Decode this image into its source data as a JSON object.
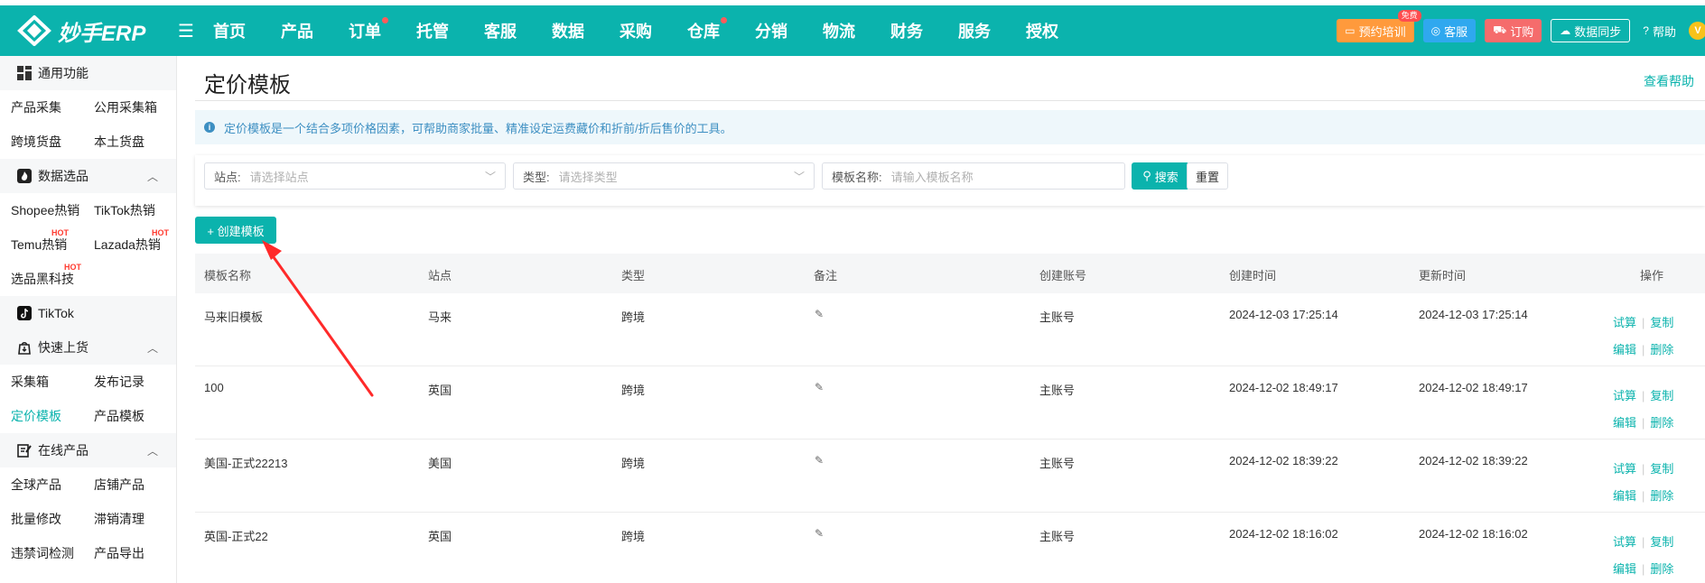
{
  "app": {
    "logo_text": "妙手ERP",
    "nav": [
      {
        "label": "首页",
        "dot": false
      },
      {
        "label": "产品",
        "dot": false
      },
      {
        "label": "订单",
        "dot": true
      },
      {
        "label": "托管",
        "dot": false
      },
      {
        "label": "客服",
        "dot": false
      },
      {
        "label": "数据",
        "dot": false
      },
      {
        "label": "采购",
        "dot": false
      },
      {
        "label": "仓库",
        "dot": true
      },
      {
        "label": "分销",
        "dot": false
      },
      {
        "label": "物流",
        "dot": false
      },
      {
        "label": "财务",
        "dot": false
      },
      {
        "label": "服务",
        "dot": false
      },
      {
        "label": "授权",
        "dot": false
      }
    ],
    "top_right": {
      "training": "预约培训",
      "free_badge": "免费",
      "service": "客服",
      "order": "订购",
      "sync": "数据同步",
      "help": "帮助",
      "avatar": "V"
    }
  },
  "sidebar": {
    "common": {
      "title": "通用功能",
      "rows": [
        [
          "产品采集",
          "公用采集箱"
        ],
        [
          "跨境货盘",
          "本土货盘"
        ]
      ]
    },
    "data": {
      "title": "数据选品",
      "rows": [
        [
          "Shopee热销",
          "TikTok热销"
        ],
        [
          "Temu热销",
          "Lazada热销"
        ],
        [
          "选品黑科技",
          ""
        ]
      ]
    },
    "hot_label": "HOT",
    "tiktok": {
      "title": "TikTok"
    },
    "quick": {
      "title": "快速上货",
      "rows": [
        [
          "采集箱",
          "发布记录"
        ],
        [
          "定价模板",
          "产品模板"
        ]
      ]
    },
    "online": {
      "title": "在线产品",
      "rows": [
        [
          "全球产品",
          "店铺产品"
        ],
        [
          "批量修改",
          "滞销清理"
        ],
        [
          "违禁词检测",
          "产品导出"
        ]
      ]
    }
  },
  "main": {
    "title": "定价模板",
    "help_link": "查看帮助",
    "info": "定价模板是一个结合多项价格因素，可帮助商家批量、精准设定运费藏价和折前/折后售价的工具。",
    "filters": {
      "site_label": "站点:",
      "site_placeholder": "请选择站点",
      "type_label": "类型:",
      "type_placeholder": "请选择类型",
      "name_label": "模板名称:",
      "name_placeholder": "请输入模板名称",
      "search": "搜索",
      "reset": "重置"
    },
    "create_button": "+ 创建模板",
    "table": {
      "headers": [
        "模板名称",
        "站点",
        "类型",
        "备注",
        "创建账号",
        "创建时间",
        "更新时间",
        "操作"
      ],
      "ops": {
        "trial": "试算",
        "copy": "复制",
        "edit": "编辑",
        "delete": "删除"
      },
      "rows": [
        {
          "name": "马来旧模板",
          "site": "马来",
          "type": "跨境",
          "account": "主账号",
          "created": "2024-12-03 17:25:14",
          "updated": "2024-12-03 17:25:14"
        },
        {
          "name": "100",
          "site": "英国",
          "type": "跨境",
          "account": "主账号",
          "created": "2024-12-02 18:49:17",
          "updated": "2024-12-02 18:49:17"
        },
        {
          "name": "美国-正式22213",
          "site": "美国",
          "type": "跨境",
          "account": "主账号",
          "created": "2024-12-02 18:39:22",
          "updated": "2024-12-02 18:39:22"
        },
        {
          "name": "英国-正式22",
          "site": "英国",
          "type": "跨境",
          "account": "主账号",
          "created": "2024-12-02 18:16:02",
          "updated": "2024-12-02 18:16:02"
        }
      ]
    }
  }
}
